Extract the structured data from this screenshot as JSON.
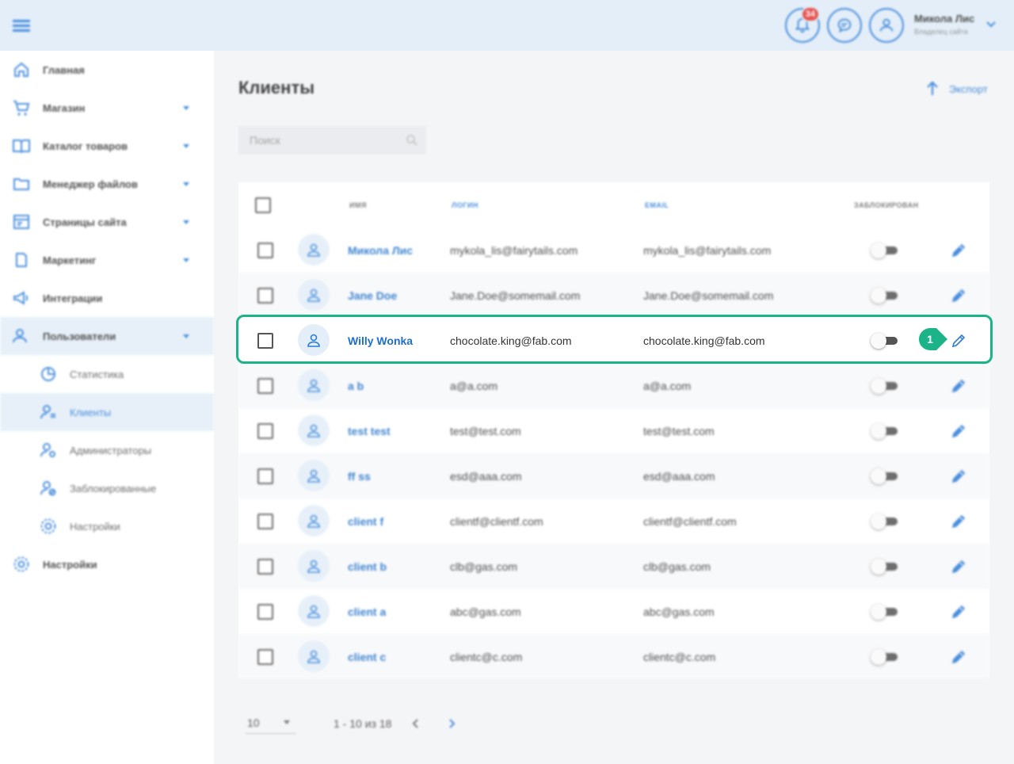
{
  "colors": {
    "accent": "#2b7bd6",
    "highlight": "#1db388",
    "badge": "#e53935",
    "topbar": "#e3eef8"
  },
  "topbar": {
    "notification_count": "34",
    "user_name": "Микола Лис",
    "user_role": "Владелец сайта"
  },
  "sidebar": {
    "items": [
      {
        "label": "Главная",
        "icon": "home-icon"
      },
      {
        "label": "Магазин",
        "icon": "cart-icon"
      },
      {
        "label": "Каталог товаров",
        "icon": "book-icon"
      },
      {
        "label": "Менеджер файлов",
        "icon": "folder-icon"
      },
      {
        "label": "Страницы сайта",
        "icon": "pages-icon"
      },
      {
        "label": "Маркетинг",
        "icon": "marketing-icon"
      },
      {
        "label": "Интеграции",
        "icon": "megaphone-icon"
      },
      {
        "label": "Пользователи",
        "icon": "users-icon"
      }
    ],
    "sub_items": [
      {
        "label": "Статистика",
        "icon": "chart-icon"
      },
      {
        "label": "Клиенты",
        "icon": "clients-icon"
      },
      {
        "label": "Администраторы",
        "icon": "admin-icon"
      },
      {
        "label": "Заблокированные",
        "icon": "blocked-users-icon"
      },
      {
        "label": "Настройки",
        "icon": "gear-icon"
      }
    ],
    "settings": {
      "label": "Настройки",
      "icon": "gear-icon"
    }
  },
  "main": {
    "title": "Клиенты",
    "export_label": "Экспорт",
    "search_placeholder": "Поиск",
    "columns": {
      "name": "Имя",
      "login": "Логин",
      "email": "Email",
      "blocked": "Заблокирован"
    },
    "rows": [
      {
        "name": "Микола Лис",
        "login": "mykola_lis@fairytails.com",
        "email": "mykola_lis@fairytails.com"
      },
      {
        "name": "Jane Doe",
        "login": "Jane.Doe@somemail.com",
        "email": "Jane.Doe@somemail.com"
      },
      {
        "name": "Willy Wonka",
        "login": "chocolate.king@fab.com",
        "email": "chocolate.king@fab.com"
      },
      {
        "name": "a b",
        "login": "a@a.com",
        "email": "a@a.com"
      },
      {
        "name": "test test",
        "login": "test@test.com",
        "email": "test@test.com"
      },
      {
        "name": "ff ss",
        "login": "esd@aaa.com",
        "email": "esd@aaa.com"
      },
      {
        "name": "client f",
        "login": "clientf@clientf.com",
        "email": "clientf@clientf.com"
      },
      {
        "name": "client b",
        "login": "clb@gas.com",
        "email": "clb@gas.com"
      },
      {
        "name": "client a",
        "login": "abc@gas.com",
        "email": "abc@gas.com"
      },
      {
        "name": "client c",
        "login": "clientc@c.com",
        "email": "clientc@c.com"
      }
    ],
    "highlight_marker": "1"
  },
  "pagination": {
    "page_size": "10",
    "range": "1 - 10 из 18"
  }
}
